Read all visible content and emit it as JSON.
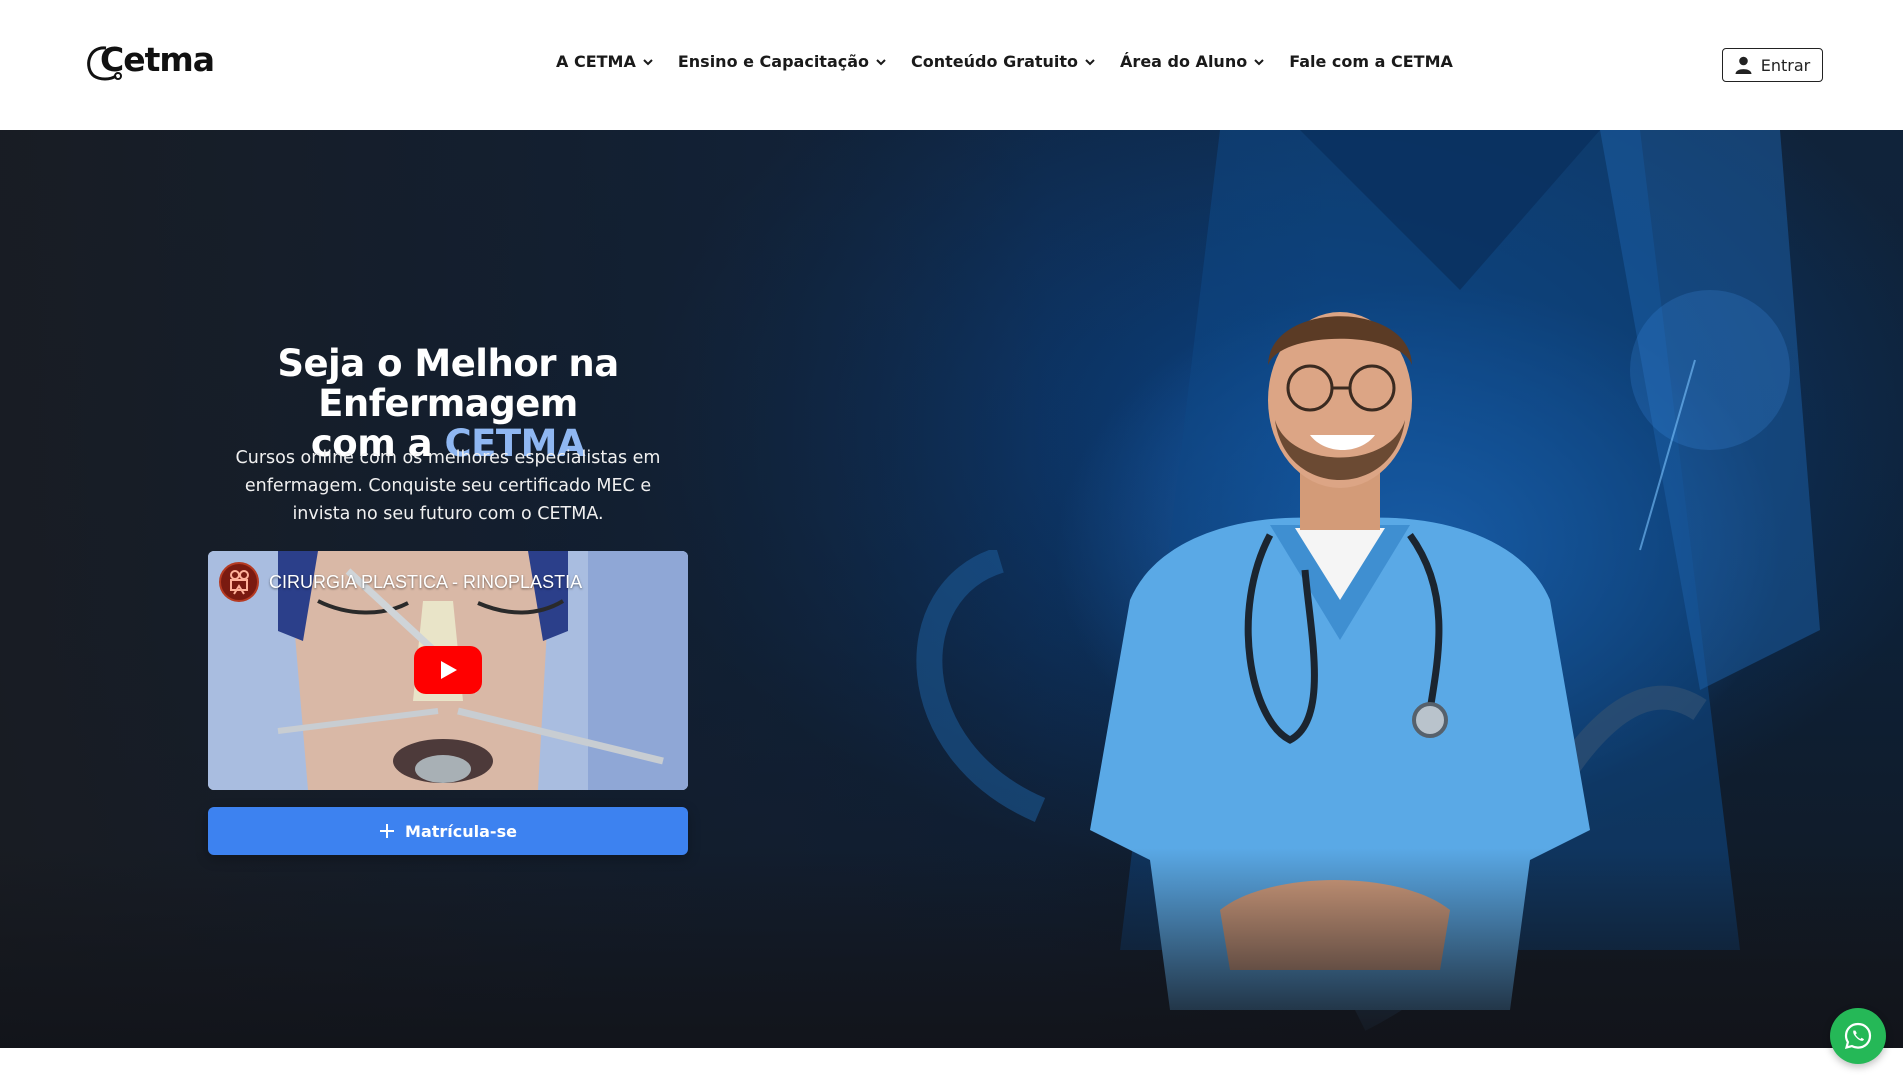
{
  "header": {
    "logo_text": "Cetma",
    "nav": [
      {
        "label": "A CETMA",
        "has_dropdown": true
      },
      {
        "label": "Ensino e Capacitação",
        "has_dropdown": true
      },
      {
        "label": "Conteúdo Gratuito",
        "has_dropdown": true
      },
      {
        "label": "Área do Aluno",
        "has_dropdown": true
      },
      {
        "label": "Fale com a CETMA",
        "has_dropdown": false
      }
    ],
    "login_label": "Entrar",
    "login_icon": "user-icon"
  },
  "hero": {
    "title_line1": "Seja o Melhor na Enfermagem",
    "title_line2_prefix": "com a ",
    "title_line2_accent": "CETMA",
    "description": "Cursos online com os melhores especialistas em enfermagem. Conquiste seu certificado MEC e invista no seu futuro com o CETMA.",
    "video": {
      "title": "CIRURGIA PLASTICA - RINOPLASTIA",
      "play_icon": "play-icon",
      "channel_icon": "channel-avatar-icon"
    },
    "cta_label": "Matrícula-se",
    "cta_icon": "plus-icon"
  },
  "colors": {
    "accent": "#8fb7f2",
    "button_blue": "#3d82f0",
    "whatsapp_green": "#25b857",
    "youtube_red": "#ff0000"
  },
  "floating": {
    "whatsapp_icon": "whatsapp-icon"
  }
}
